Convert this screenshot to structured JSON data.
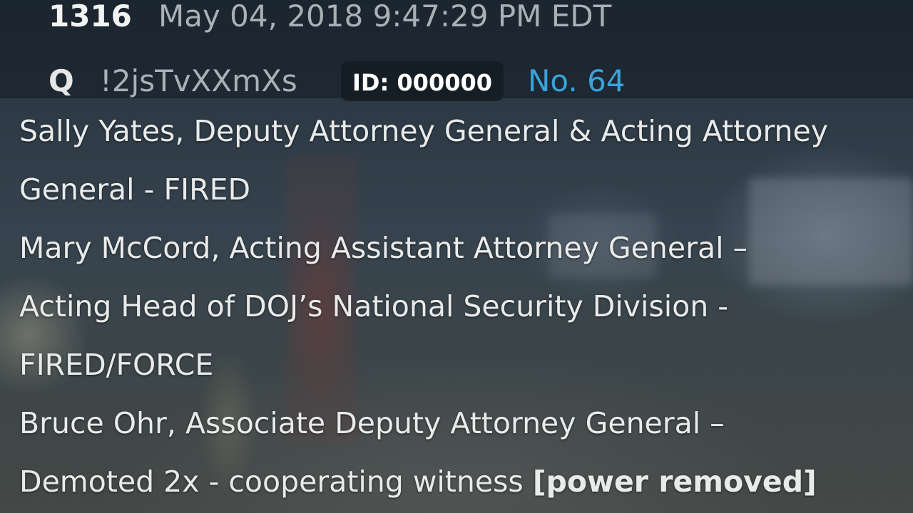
{
  "post": {
    "number": "1316",
    "date": "May 04, 2018 9:47:29 PM EDT",
    "author": "Q",
    "tripcode": "!2jsTvXXmXs",
    "id_badge": "ID: 000000",
    "post_no": "No. 64"
  },
  "body": {
    "lines": [
      "Sally Yates, Deputy Attorney General & Acting Attorney",
      "General - FIRED",
      "Mary McCord, Acting Assistant Attorney General –",
      "Acting Head of DOJ’s National Security Division -",
      "FIRED/FORCE",
      "Bruce Ohr, Associate Deputy Attorney General –"
    ],
    "last_line_plain": "Demoted 2x - cooperating witness ",
    "last_line_bold": "[power removed]"
  },
  "colors": {
    "post_no": "#3aa3d9",
    "text": "#e9eaea",
    "muted": "#a9b0b6"
  }
}
